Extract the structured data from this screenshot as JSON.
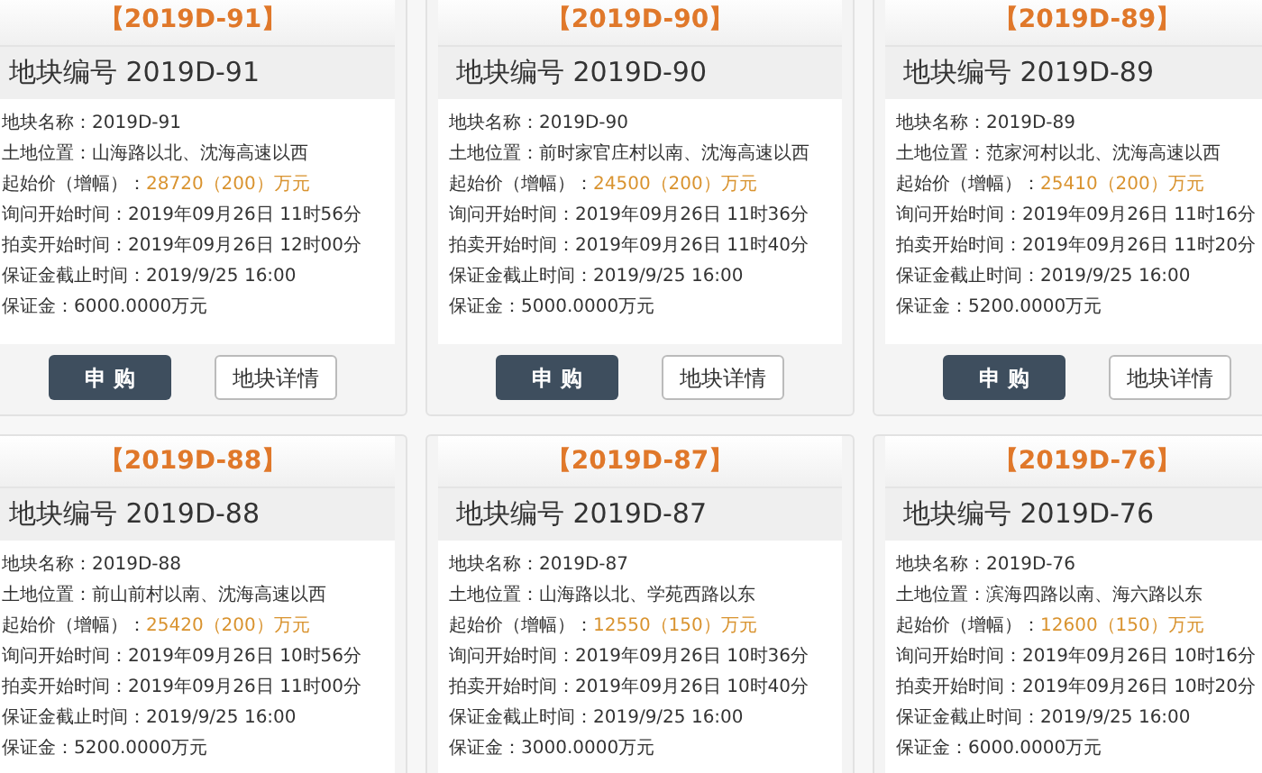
{
  "cards": [
    {
      "header": "【2019D-91】",
      "title": "地块编号 2019D-91",
      "fields": [
        {
          "kind": "plain",
          "label": "地块名称：",
          "value": "2019D-91"
        },
        {
          "kind": "plain",
          "label": "土地位置：",
          "value": "山海路以北、沈海高速以西"
        },
        {
          "kind": "price",
          "label": "起始价（增幅）：",
          "value": "28720（200）万元"
        },
        {
          "kind": "plain",
          "label": "询问开始时间：",
          "value": "2019年09月26日 11时56分"
        },
        {
          "kind": "plain",
          "label": "拍卖开始时间：",
          "value": "2019年09月26日 12时00分"
        },
        {
          "kind": "plain",
          "label": "保证金截止时间：",
          "value": "2019/9/25 16:00"
        },
        {
          "kind": "plain",
          "label": "保证金：",
          "value": "6000.0000万元"
        }
      ],
      "buttons": [
        "申 购",
        "地块详情"
      ]
    },
    {
      "header": "【2019D-90】",
      "title": "地块编号 2019D-90",
      "fields": [
        {
          "kind": "plain",
          "label": "地块名称：",
          "value": "2019D-90"
        },
        {
          "kind": "plain",
          "label": "土地位置：",
          "value": "前时家官庄村以南、沈海高速以西"
        },
        {
          "kind": "price",
          "label": "起始价（增幅）：",
          "value": "24500（200）万元"
        },
        {
          "kind": "plain",
          "label": "询问开始时间：",
          "value": "2019年09月26日 11时36分"
        },
        {
          "kind": "plain",
          "label": "拍卖开始时间：",
          "value": "2019年09月26日 11时40分"
        },
        {
          "kind": "plain",
          "label": "保证金截止时间：",
          "value": "2019/9/25 16:00"
        },
        {
          "kind": "plain",
          "label": "保证金：",
          "value": "5000.0000万元"
        }
      ],
      "buttons": [
        "申 购",
        "地块详情"
      ]
    },
    {
      "header": "【2019D-89】",
      "title": "地块编号 2019D-89",
      "fields": [
        {
          "kind": "plain",
          "label": "地块名称：",
          "value": "2019D-89"
        },
        {
          "kind": "plain",
          "label": "土地位置：",
          "value": "范家河村以北、沈海高速以西"
        },
        {
          "kind": "price",
          "label": "起始价（增幅）：",
          "value": "25410（200）万元"
        },
        {
          "kind": "plain",
          "label": "询问开始时间：",
          "value": "2019年09月26日 11时16分"
        },
        {
          "kind": "plain",
          "label": "拍卖开始时间：",
          "value": "2019年09月26日 11时20分"
        },
        {
          "kind": "plain",
          "label": "保证金截止时间：",
          "value": "2019/9/25 16:00"
        },
        {
          "kind": "plain",
          "label": "保证金：",
          "value": "5200.0000万元"
        }
      ],
      "buttons": [
        "申 购",
        "地块详情"
      ]
    },
    {
      "header": "【2019D-88】",
      "title": "地块编号 2019D-88",
      "fields": [
        {
          "kind": "plain",
          "label": "地块名称：",
          "value": "2019D-88"
        },
        {
          "kind": "plain",
          "label": "土地位置：",
          "value": "前山前村以南、沈海高速以西"
        },
        {
          "kind": "price",
          "label": "起始价（增幅）：",
          "value": "25420（200）万元"
        },
        {
          "kind": "plain",
          "label": "询问开始时间：",
          "value": "2019年09月26日 10时56分"
        },
        {
          "kind": "plain",
          "label": "拍卖开始时间：",
          "value": "2019年09月26日 11时00分"
        },
        {
          "kind": "plain",
          "label": "保证金截止时间：",
          "value": "2019/9/25 16:00"
        },
        {
          "kind": "plain",
          "label": "保证金：",
          "value": "5200.0000万元"
        }
      ]
    },
    {
      "header": "【2019D-87】",
      "title": "地块编号 2019D-87",
      "fields": [
        {
          "kind": "plain",
          "label": "地块名称：",
          "value": "2019D-87"
        },
        {
          "kind": "plain",
          "label": "土地位置：",
          "value": "山海路以北、学苑西路以东"
        },
        {
          "kind": "price",
          "label": "起始价（增幅）：",
          "value": "12550（150）万元"
        },
        {
          "kind": "plain",
          "label": "询问开始时间：",
          "value": "2019年09月26日 10时36分"
        },
        {
          "kind": "plain",
          "label": "拍卖开始时间：",
          "value": "2019年09月26日 10时40分"
        },
        {
          "kind": "plain",
          "label": "保证金截止时间：",
          "value": "2019/9/25 16:00"
        },
        {
          "kind": "plain",
          "label": "保证金：",
          "value": "3000.0000万元"
        }
      ]
    },
    {
      "header": "【2019D-76】",
      "title": "地块编号 2019D-76",
      "fields": [
        {
          "kind": "plain",
          "label": "地块名称：",
          "value": "2019D-76"
        },
        {
          "kind": "plain",
          "label": "土地位置：",
          "value": "滨海四路以南、海六路以东"
        },
        {
          "kind": "price",
          "label": "起始价（增幅）：",
          "value": "12600（150）万元"
        },
        {
          "kind": "plain",
          "label": "询问开始时间：",
          "value": "2019年09月26日 10时16分"
        },
        {
          "kind": "plain",
          "label": "拍卖开始时间：",
          "value": "2019年09月26日 10时20分"
        },
        {
          "kind": "plain",
          "label": "保证金截止时间：",
          "value": "2019/9/25 16:00"
        },
        {
          "kind": "plain",
          "label": "保证金：",
          "value": "6000.0000万元"
        }
      ]
    }
  ]
}
